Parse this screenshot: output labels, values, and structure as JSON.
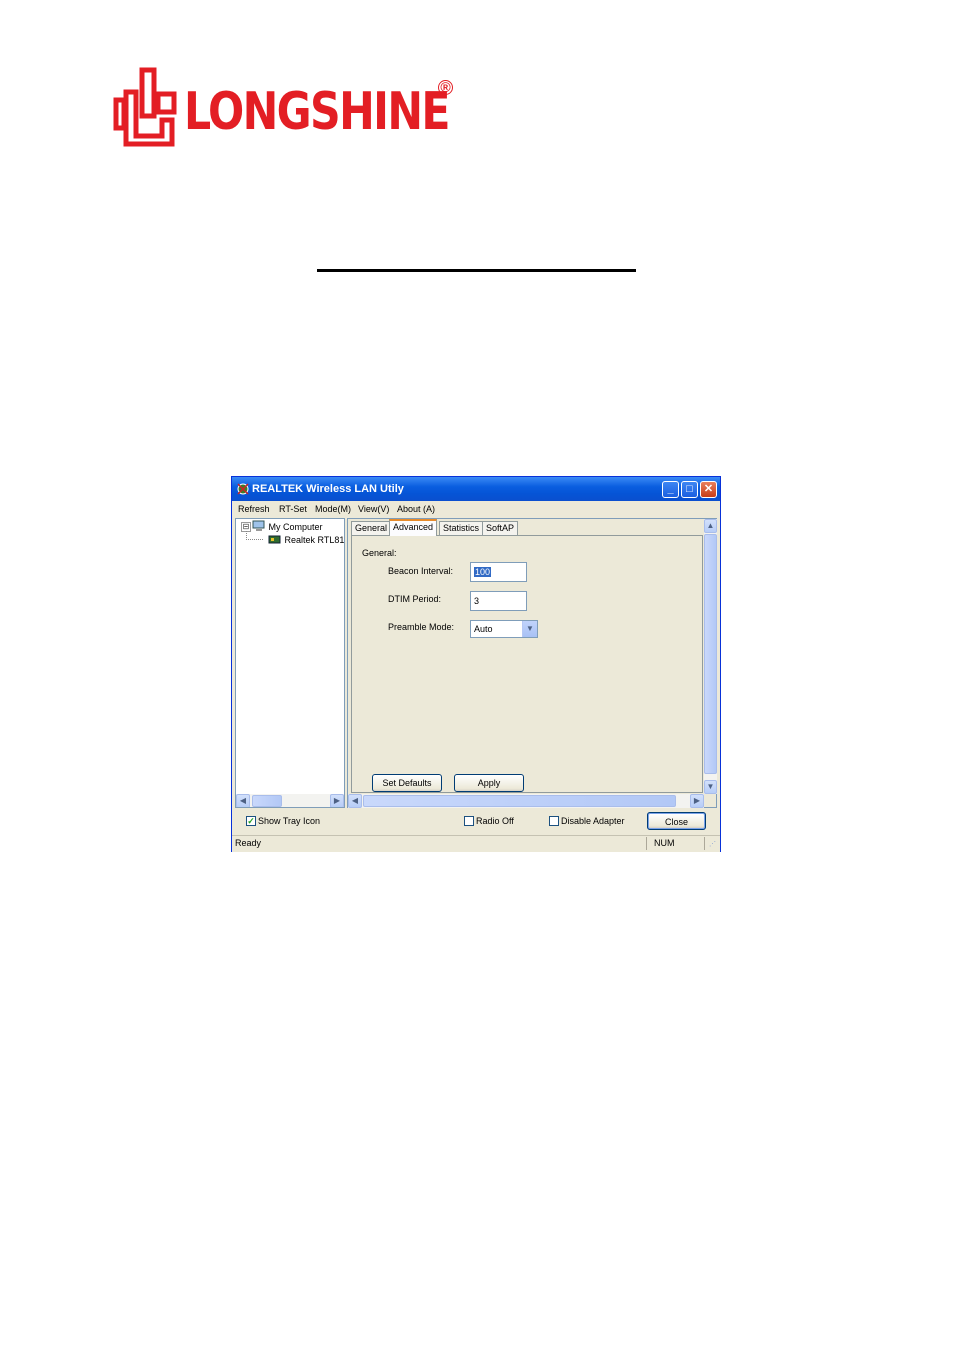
{
  "logo": {
    "text": "LONGSHINE",
    "registered": "®"
  },
  "window": {
    "title": "REALTEK Wireless LAN Utily",
    "controls": {
      "minimize": "_",
      "maximize": "□",
      "close": "✕"
    }
  },
  "menu": [
    "Refresh",
    "RT-Set",
    "Mode(M)",
    "View(V)",
    "About (A)"
  ],
  "tree": {
    "root": "My Computer",
    "child": "Realtek RTL81",
    "toggle": "⊟"
  },
  "tabs": [
    "General",
    "Advanced",
    "Statistics",
    "SoftAP"
  ],
  "active_tab": "Advanced",
  "advanced": {
    "group_label": "General:",
    "beacon_label": "Beacon Interval:",
    "beacon_value": "100",
    "dtim_label": "DTIM Period:",
    "dtim_value": "3",
    "preamble_label": "Preamble Mode:",
    "preamble_value": "Auto",
    "set_defaults": "Set Defaults",
    "apply": "Apply"
  },
  "bottom": {
    "show_tray": "Show Tray Icon",
    "show_tray_checked": true,
    "radio_off": "Radio Off",
    "disable_adapter": "Disable Adapter",
    "close": "Close",
    "checkmark": "✓"
  },
  "status": {
    "left": "Ready",
    "num": "NUM"
  },
  "colors": {
    "logo_red": "#e31e24",
    "titlebar_blue": "#0a5ee0"
  }
}
